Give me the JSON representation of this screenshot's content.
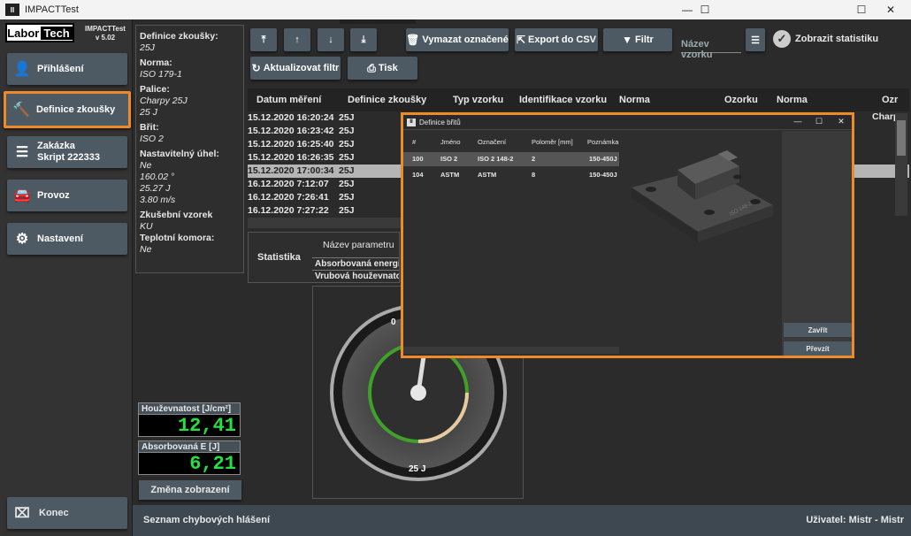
{
  "window": {
    "title": "IMPACTTest",
    "icon_text": "II"
  },
  "logo": {
    "part1": "Labor",
    "part2": "Tech"
  },
  "app_info": {
    "name": "IMPACTTest",
    "version": "v 5.02"
  },
  "nav": {
    "login": "Přihlášení",
    "test_def": "Definice zkoušky",
    "order_l1": "Zakázka",
    "order_l2": "Skript 222333",
    "operation": "Provoz",
    "settings": "Nastavení",
    "end": "Konec"
  },
  "info": {
    "def_label": "Definice zkoušky:",
    "def_val": "25J",
    "norm_label": "Norma:",
    "norm_val": "ISO 179-1",
    "striker_label": "Palice:",
    "striker_val1": "Charpy 25J",
    "striker_val2": "25 J",
    "edge_label": "Břit:",
    "edge_val": "ISO 2",
    "angle_label": "Nastavitelný úhel:",
    "angle_val1": "Ne",
    "angle_val2": "160.02 °",
    "angle_val3": "25.27 J",
    "angle_val4": "3.80 m/s",
    "specimen_label": "Zkušební vzorek",
    "specimen_val": "KU",
    "chamber_label": "Teplotní komora:",
    "chamber_val": "Ne"
  },
  "meters": {
    "toughness_label": "Houževnatost [J/cm²]",
    "toughness_val": "12,41",
    "energy_label": "Absorbovaná E [J]",
    "energy_val": "6,21",
    "switch_label": "Změna zobrazení"
  },
  "toolbar": {
    "clear_marked": "Vymazat označené",
    "export_csv": "Export do CSV",
    "filter": "Filtr",
    "search_placeholder": "Název vzorku",
    "show_stats": "Zobrazit statistiku",
    "refresh_filter": "Aktualizovat filtr",
    "print": "Tisk"
  },
  "grid": {
    "headers": [
      "Datum měření",
      "Definice zkoušky",
      "Typ vzorku",
      "Identifikace vzorku",
      "Norma",
      "Ozorku",
      "Norma",
      "Ozr"
    ],
    "rows": [
      {
        "date": "15.12.2020 16:20:24",
        "def": "25J"
      },
      {
        "date": "15.12.2020 16:23:42",
        "def": "25J"
      },
      {
        "date": "15.12.2020 16:25:40",
        "def": "25J"
      },
      {
        "date": "15.12.2020 16:26:35",
        "def": "25J"
      },
      {
        "date": "15.12.2020 17:00:34",
        "def": "25J"
      },
      {
        "date": "16.12.2020 7:12:07",
        "def": "25J"
      },
      {
        "date": "16.12.2020 7:26:41",
        "def": "25J"
      },
      {
        "date": "16.12.2020 7:27:22",
        "def": "25J"
      }
    ],
    "right_first": "Charp"
  },
  "stats": {
    "label": "Statistika",
    "col_header": "Název parametru",
    "rows": [
      "Absorbovaná energie",
      "Vrubová houževnatost"
    ]
  },
  "gauge": {
    "top_label": "0",
    "bottom_label": "25 J"
  },
  "status": {
    "errors": "Seznam chybových hlášení",
    "user": "Uživatel: Mistr - Mistr"
  },
  "dialog": {
    "title": "Definice břitů",
    "headers": [
      "#",
      "Jméno",
      "Označení",
      "Poloměr [mm]",
      "Poznámka"
    ],
    "rows": [
      [
        "100",
        "ISO 2",
        "ISO 2 148-2",
        "2",
        "150-450J"
      ],
      [
        "104",
        "ASTM",
        "ASTM",
        "8",
        "150-450J"
      ]
    ],
    "close": "Zavřít",
    "take": "Převzít",
    "part_label": "ISO 148-2"
  }
}
